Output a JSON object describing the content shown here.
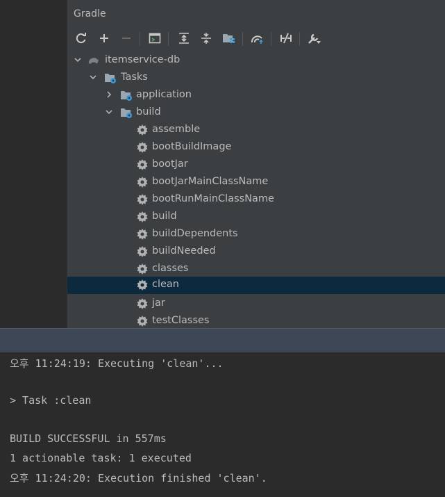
{
  "panel": {
    "title": "Gradle"
  },
  "toolbar": {
    "buttons": [
      "refresh-icon",
      "plus-icon",
      "minus-icon",
      "execute-task-icon",
      "expand-all-icon",
      "collapse-all-icon",
      "dependencies-icon",
      "offline-mode-icon",
      "toggle-skip-tests-icon",
      "build-tool-settings-icon"
    ]
  },
  "tree": {
    "project": "itemservice-db",
    "tasks": "Tasks",
    "group_application": "application",
    "group_build": "build",
    "items": [
      "assemble",
      "bootBuildImage",
      "bootJar",
      "bootJarMainClassName",
      "bootRunMainClassName",
      "build",
      "buildDependents",
      "buildNeeded",
      "classes",
      "clean",
      "jar",
      "testClasses"
    ],
    "selected": "clean"
  },
  "console": {
    "line1": "오후 11:24:19: Executing 'clean'...",
    "line2": "> Task :clean",
    "line3": "BUILD SUCCESSFUL in 557ms",
    "line4": "1 actionable task: 1 executed",
    "line5": "오후 11:24:20: Execution finished 'clean'."
  },
  "colors": {
    "panel_bg": "#3c3f41",
    "selection": "#0d293e",
    "text": "#bbbbbb",
    "gear_blue": "#3d9ad8"
  }
}
